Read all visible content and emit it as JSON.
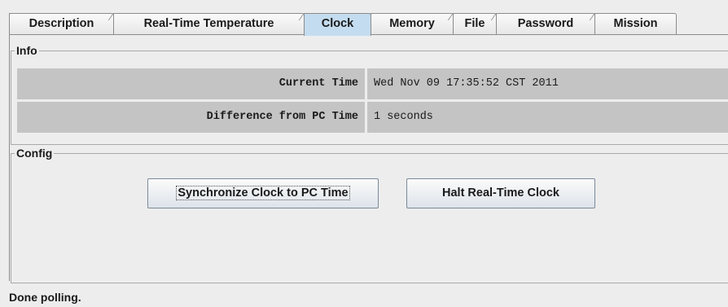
{
  "tabs": [
    {
      "label": "Description",
      "selected": false
    },
    {
      "label": "Real-Time Temperature",
      "selected": false
    },
    {
      "label": "Clock",
      "selected": true
    },
    {
      "label": "Memory",
      "selected": false
    },
    {
      "label": "File",
      "selected": false
    },
    {
      "label": "Password",
      "selected": false
    },
    {
      "label": "Mission",
      "selected": false
    }
  ],
  "info": {
    "title": "Info",
    "rows": [
      {
        "label": "Current Time",
        "value": "Wed Nov 09 17:35:52 CST 2011"
      },
      {
        "label": "Difference from PC Time",
        "value": "1 seconds"
      }
    ]
  },
  "config": {
    "title": "Config",
    "sync_label": "Synchronize Clock to PC Time",
    "halt_label": "Halt Real-Time Clock"
  },
  "status": "Done polling.",
  "colors": {
    "selected_tab": "#c4dcef",
    "row_background": "#c4c4c4",
    "window_background": "#ededed"
  }
}
